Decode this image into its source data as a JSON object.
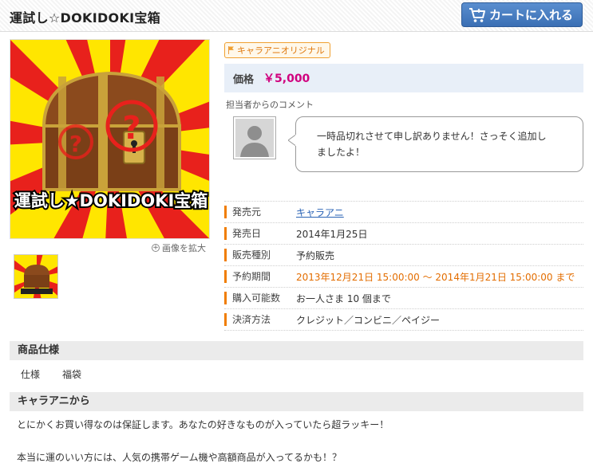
{
  "header": {
    "title": "運試し☆DOKIDOKI宝箱",
    "cart_button": "カートに入れる"
  },
  "image": {
    "banner_text": "運試し★DOKIDOKI宝箱",
    "zoom_label": "画像を拡大"
  },
  "badge": "キャラアニオリジナル",
  "price": {
    "label": "価格",
    "value": "￥5,000"
  },
  "comment": {
    "label": "担当者からのコメント",
    "text_line1": "一時品切れさせて申し訳ありません！さっそく追加し",
    "text_line2": "ましたよ！"
  },
  "specs": [
    {
      "key": "発売元",
      "value": "キャラアニ"
    },
    {
      "key": "発売日",
      "value": "2014年1月25日"
    },
    {
      "key": "販売種別",
      "value": "予約販売"
    },
    {
      "key": "予約期間",
      "value": "2013年12月21日 15:00:00 〜 2014年1月21日 15:00:00 まで"
    },
    {
      "key": "購入可能数",
      "value": "お一人さま 10 個まで"
    },
    {
      "key": "決済方法",
      "value": "クレジット／コンビニ／ペイジー"
    }
  ],
  "product_spec": {
    "heading": "商品仕様",
    "key": "仕様",
    "value": "福袋"
  },
  "from_section": {
    "heading": "キャラアニから",
    "line1": "とにかくお買い得なのは保証します。あなたの好きなものが入っていたら超ラッキー！",
    "line2": "本当に運のいい方には、人気の携帯ゲーム機や高額商品が入ってるかも！？"
  },
  "colors": {
    "accent_orange": "#f07d00",
    "price_magenta": "#d0007e",
    "cart_blue": "#3a6fb4",
    "link_blue": "#2a63b5"
  }
}
